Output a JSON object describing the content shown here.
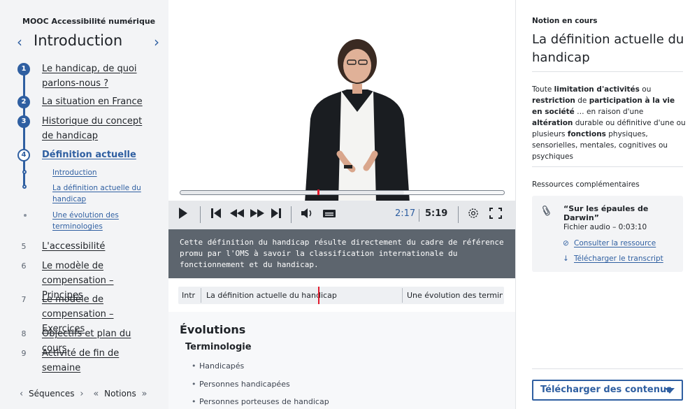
{
  "course": {
    "title": "MOOC Accessibilité numérique"
  },
  "section": {
    "prev_icon": "chevron-left-icon",
    "title": "Introduction",
    "next_icon": "chevron-right-icon"
  },
  "sequences": [
    {
      "num": "1",
      "label": "Le handicap, de quoi parlons-nous ?"
    },
    {
      "num": "2",
      "label": "La situation en France"
    },
    {
      "num": "3",
      "label": "Historique du concept de handicap"
    },
    {
      "num": "4",
      "label": "Définition actuelle"
    },
    {
      "num": "5",
      "label": "L'accessibilité"
    },
    {
      "num": "6",
      "label": "Le modèle de compensation – Principes"
    },
    {
      "num": "7",
      "label": "Le modèle de compensation – Exercices"
    },
    {
      "num": "8",
      "label": "Objectifs et plan du cours"
    },
    {
      "num": "9",
      "label": "Activité de fin de semaine"
    }
  ],
  "subitems": [
    {
      "label": "Introduction"
    },
    {
      "label": "La définition actuelle du handicap"
    },
    {
      "label": "Une évolution des terminologies"
    }
  ],
  "bottom_nav": {
    "sequences": "Séquences",
    "notions": "Notions"
  },
  "player": {
    "progress": 0.423,
    "time_current": "2:17",
    "time_total": "5:19",
    "caption": "Cette définition du handicap résulte directement du cadre de référence promu par l'OMS à savoir la classification internationale du fonctionnement et du handicap."
  },
  "timeline": {
    "seg1": "Intr",
    "seg2": "La définition actuelle du handicap",
    "seg3": "Une évolution des termin"
  },
  "notes": {
    "heading": "Évolutions",
    "subheading": "Terminologie",
    "items": [
      "Handicapés",
      "Personnes handicapées",
      "Personnes porteuses de handicap"
    ]
  },
  "notion": {
    "label": "Notion en cours",
    "title": "La définition actuelle du handicap",
    "def": {
      "t1": "Toute ",
      "b1": "limitation d'activités",
      "t2": " ou ",
      "b2": "restriction",
      "t3": " de ",
      "b3": "participation à la vie en société",
      "t4": " … en raison d'une ",
      "b4": "altération",
      "t5": " durable ou définitive d'une ou plusieurs ",
      "b5": "fonctions",
      "t6": " physiques, sensorielles, mentales, cognitives ou psychiques"
    }
  },
  "resources": {
    "label": "Ressources complémentaires",
    "title": "“Sur les épaules de Darwin”",
    "meta": "Fichier audio – 0:03:10",
    "consult": "Consulter la ressource",
    "download": "Télécharger le transcript"
  },
  "download_button": {
    "label": "Télécharger des contenus"
  },
  "colors": {
    "accent": "#2f5fa1",
    "marker": "#e21a2c",
    "caption_bg": "#5d656e"
  }
}
